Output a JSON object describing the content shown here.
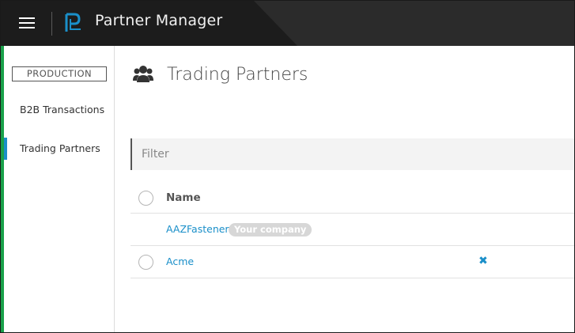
{
  "header": {
    "app_title": "Partner Manager",
    "menu_icon": "hamburger-menu-icon",
    "logo_icon": "product-logo-icon"
  },
  "sidebar": {
    "environment": "PRODUCTION",
    "items": [
      {
        "label": "B2B Transactions",
        "active": false
      },
      {
        "label": "Trading Partners",
        "active": true
      }
    ]
  },
  "main": {
    "title": "Trading Partners",
    "title_icon": "users-group-icon",
    "filter": {
      "placeholder": "Filter",
      "value": ""
    },
    "table": {
      "columns": [
        "Name"
      ],
      "rows": [
        {
          "name": "AAZFasteners",
          "badge": "Your company",
          "selectable": false,
          "deletable": false
        },
        {
          "name": "Acme",
          "badge": "",
          "selectable": true,
          "deletable": true
        }
      ]
    }
  },
  "colors": {
    "accent": "#1a8fc9",
    "topbar": "#2b2b2b",
    "badge": "#d7d7d7",
    "left_edge": "#1aa14a"
  }
}
